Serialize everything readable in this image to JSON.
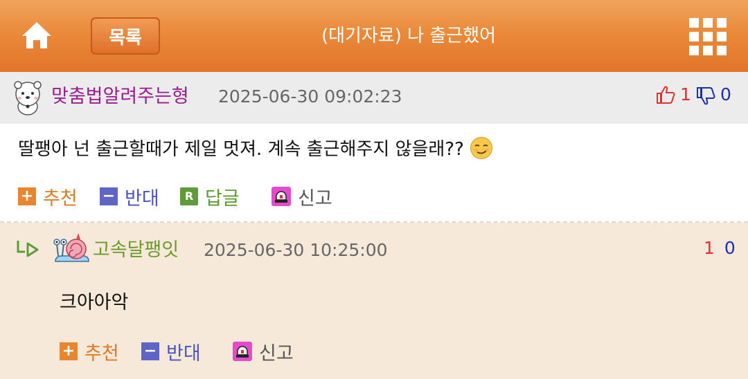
{
  "header": {
    "home_icon": "home-icon",
    "list_label": "목록",
    "title": "(대기자료) 나 출근했어",
    "menu_icon": "grid-menu-icon"
  },
  "comments": [
    {
      "author": "맞춤법알려주는형",
      "date": "2025-06-30 09:02:23",
      "upvotes": "1",
      "downvotes": "0",
      "text": "딸팽아 넌 출근할때가 제일 멋져. 계속 출근해주지 않을래??",
      "emoji": "smirking-face",
      "author_color": "#9a1d8f",
      "actions": {
        "recommend": "추천",
        "oppose": "반대",
        "reply": "답글",
        "report": "신고"
      }
    },
    {
      "author": "고속달팽잇",
      "date": "2025-06-30 10:25:00",
      "upvotes": "1",
      "downvotes": "0",
      "text": "크아아악",
      "author_color": "#6a9a2a",
      "actions": {
        "recommend": "추천",
        "oppose": "반대",
        "report": "신고"
      }
    }
  ],
  "colors": {
    "header_orange": "#e2752a",
    "reply_background": "#f7e9d9",
    "upvote_red": "#e03030",
    "downvote_blue": "#1a2fb0"
  }
}
